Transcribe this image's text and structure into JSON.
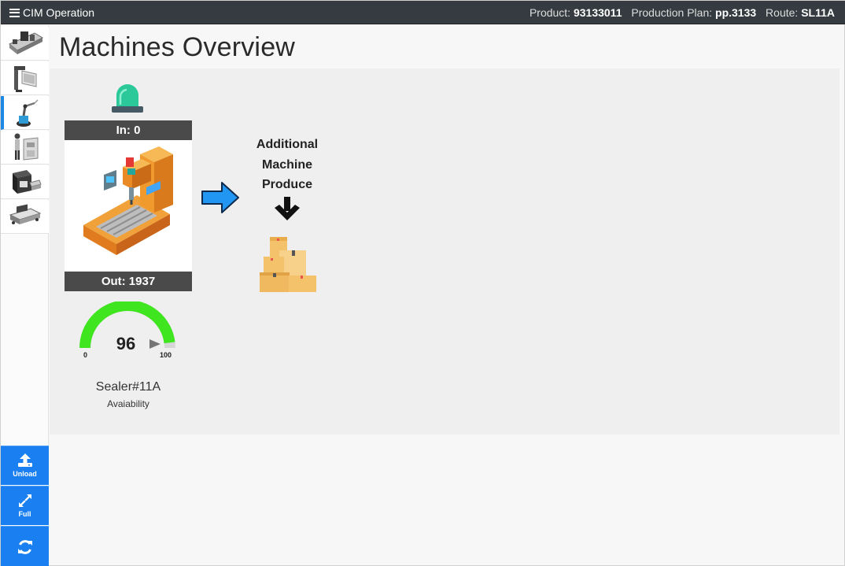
{
  "header": {
    "app_title": "CIM Operation",
    "product_label": "Product:",
    "product_value": "93133011",
    "plan_label": "Production Plan:",
    "plan_value": "pp.3133",
    "route_label": "Route:",
    "route_value": "SL11A"
  },
  "sidebar": {
    "items": [
      {
        "name": "machine-line-1"
      },
      {
        "name": "machine-press"
      },
      {
        "name": "machine-robot-arm",
        "active": true
      },
      {
        "name": "machine-operator-station"
      },
      {
        "name": "machine-packager"
      },
      {
        "name": "machine-conveyor"
      }
    ],
    "buttons": {
      "unload_label": "Unload",
      "full_label": "Full",
      "refresh_label": ""
    }
  },
  "page": {
    "title": "Machines Overview"
  },
  "machine": {
    "in_label": "In: 0",
    "out_label": "Out: 1937",
    "name": "Sealer#11A",
    "metric_label": "Avaiability",
    "status_color": "#2bc99a",
    "gauge": {
      "value": 96,
      "min": 0,
      "max": 100,
      "fill_color": "#3fe61f"
    }
  },
  "flow": {
    "additional_line1": "Additional",
    "additional_line2": "Machine",
    "additional_line3": "Produce",
    "arrow_color": "#2196f3"
  }
}
